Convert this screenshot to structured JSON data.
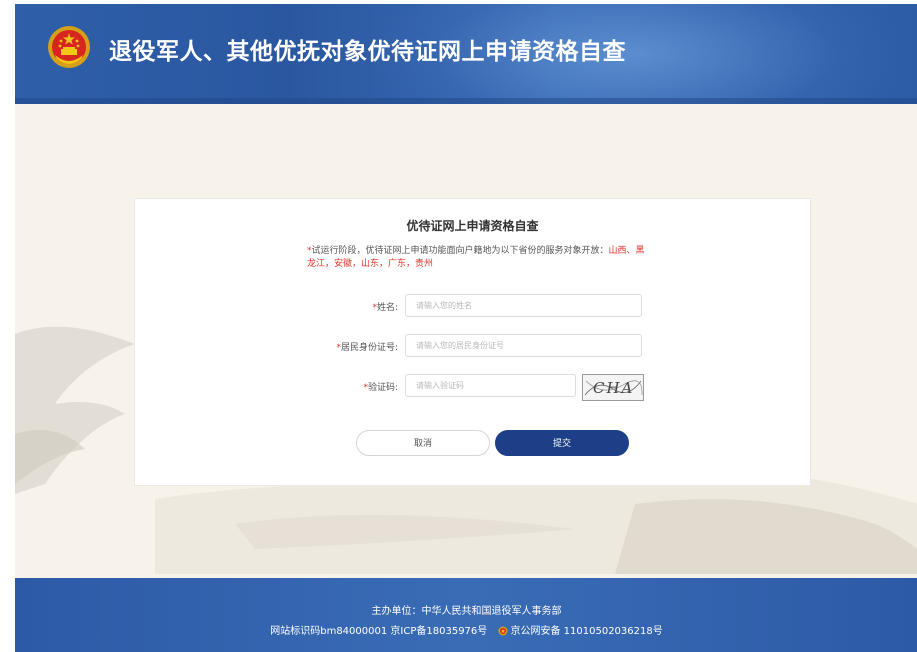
{
  "header": {
    "title": "退役军人、其他优抚对象优待证网上申请资格自查",
    "emblem_icon": "national-emblem-icon"
  },
  "form": {
    "title": "优待证网上申请资格自查",
    "notice_text": "试运行阶段，优待证网上申请功能面向户籍地为以下省份的服务对象开放：",
    "notice_provinces": "山西、黑龙江，安徽，山东，广东，贵州",
    "required_mark": "*",
    "name_label": "姓名:",
    "name_placeholder": "请输入您的姓名",
    "id_label": "居民身份证号:",
    "id_placeholder": "请输入您的居民身份证号",
    "captcha_label": "验证码:",
    "captcha_placeholder": "请输入验证码",
    "captcha_text": "CHA",
    "cancel_label": "取消",
    "submit_label": "提交"
  },
  "footer": {
    "sponsor": "主办单位：中华人民共和国退役军人事务部",
    "site_id": "网站标识码bm84000001",
    "icp": "京ICP备18035976号",
    "police_record": "京公网安备 11010502036218号"
  },
  "colors": {
    "header_blue": "#2f5fa9",
    "button_blue": "#1c3f87",
    "required_red": "#e0362b",
    "page_bg": "#f7f3ea"
  }
}
